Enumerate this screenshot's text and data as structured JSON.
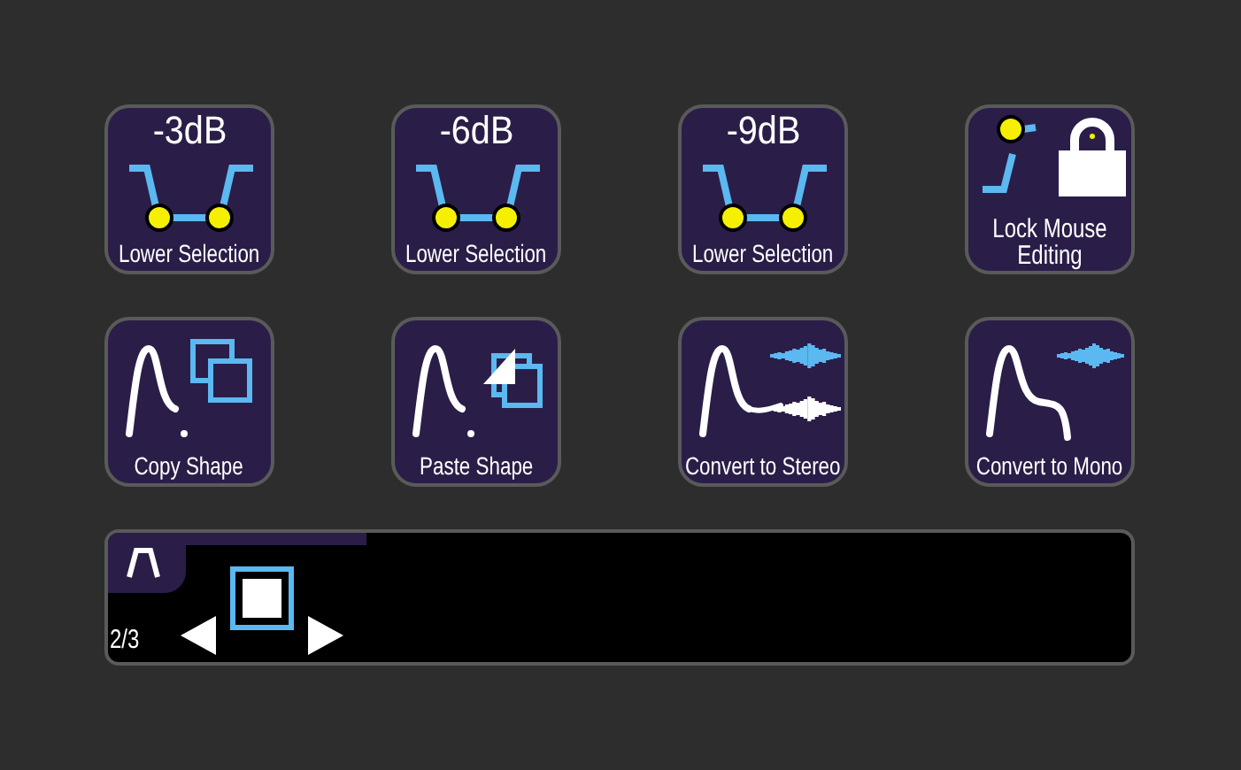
{
  "buttons": [
    {
      "kind": "lower",
      "top": "-3dB",
      "label": "Lower Selection"
    },
    {
      "kind": "lower",
      "top": "-6dB",
      "label": "Lower Selection"
    },
    {
      "kind": "lower",
      "top": "-9dB",
      "label": "Lower Selection"
    },
    {
      "kind": "lock",
      "label": "Lock Mouse Editing"
    },
    {
      "kind": "copy",
      "label": "Copy Shape"
    },
    {
      "kind": "paste",
      "label": "Paste Shape"
    },
    {
      "kind": "stereo",
      "label": "Convert to Stereo"
    },
    {
      "kind": "mono",
      "label": "Convert to Mono"
    }
  ],
  "panel": {
    "page": "2/3"
  }
}
